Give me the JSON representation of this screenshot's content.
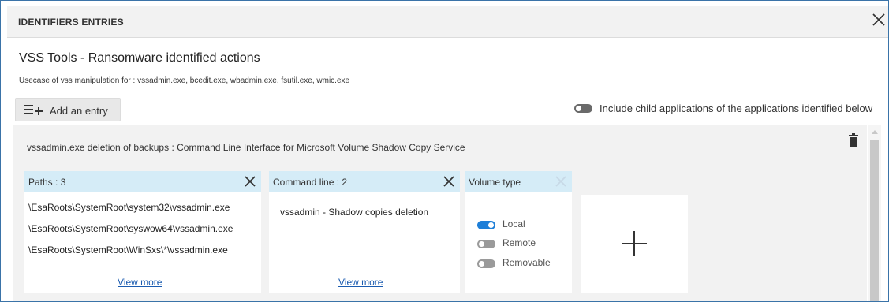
{
  "dialog": {
    "header_title": "IDENTIFIERS ENTRIES",
    "title": "VSS Tools - Ransomware identified actions",
    "subtitle": "Usecase of vss manipulation for : vssadmin.exe, bcedit.exe, wbadmin.exe, fsutil.exe, wmic.exe",
    "close_icon": "close-icon"
  },
  "toolbar": {
    "add_entry_label": "Add an entry",
    "add_entry_icon": "list-add-icon",
    "include_children_label": "Include child applications of the applications identified below",
    "include_children_enabled": false
  },
  "entry": {
    "title": "vssadmin.exe deletion of backups : Command Line Interface for Microsoft Volume Shadow Copy Service",
    "delete_icon": "trash-icon",
    "paths_card": {
      "title": "Paths : 3",
      "items": [
        "\\EsaRoots\\SystemRoot\\system32\\vssadmin.exe",
        "\\EsaRoots\\SystemRoot\\syswow64\\vssadmin.exe",
        "\\EsaRoots\\SystemRoot\\WinSxs\\*\\vssadmin.exe"
      ],
      "view_more": "View more"
    },
    "command_card": {
      "title": "Command line : 2",
      "items": [
        "vssadmin - Shadow copies deletion"
      ],
      "view_more": "View more"
    },
    "volume_card": {
      "title": "Volume type",
      "options": [
        {
          "label": "Local",
          "enabled": true
        },
        {
          "label": "Remote",
          "enabled": false
        },
        {
          "label": "Removable",
          "enabled": false
        }
      ]
    },
    "add_card_icon": "plus-icon"
  },
  "colors": {
    "card_header": "#d5ecf7",
    "toggle_on": "#1e7fd8",
    "toggle_off": "#9a9a9a",
    "link": "#1a5bb0",
    "frame_border": "#3a73a8"
  }
}
